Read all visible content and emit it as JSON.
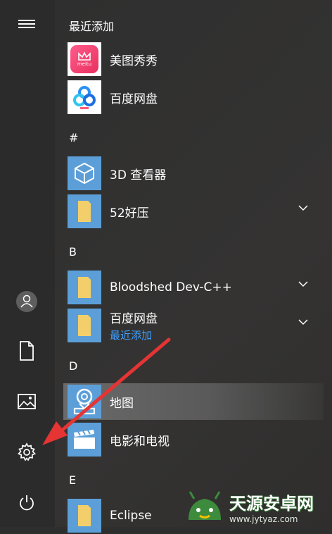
{
  "sections": {
    "recent": "最近添加",
    "hash": "#",
    "b": "B",
    "d": "D",
    "e": "E"
  },
  "apps": {
    "meitu": "美图秀秀",
    "meitu_icon_text": "meitu",
    "baidu_recent": "百度网盘",
    "viewer3d": "3D 查看器",
    "52haoya": "52好压",
    "bloodshed": "Bloodshed Dev-C++",
    "baidu_folder": "百度网盘",
    "baidu_folder_sub": "最近添加",
    "map": "地图",
    "movies": "电影和电视",
    "eclipse": "Eclipse"
  },
  "rail": {
    "items": [
      "hamburger-icon",
      "user-icon",
      "document-icon",
      "picture-icon",
      "gear-icon",
      "power-icon"
    ]
  },
  "watermark": {
    "title": "天源安卓网",
    "url": "www.jytyaz.com"
  },
  "colors": {
    "tile_blue": "#5c9fd8",
    "folder_yellow": "#f3cf6b",
    "annotation_red": "#e53434",
    "accent_link": "#3f9fff"
  }
}
